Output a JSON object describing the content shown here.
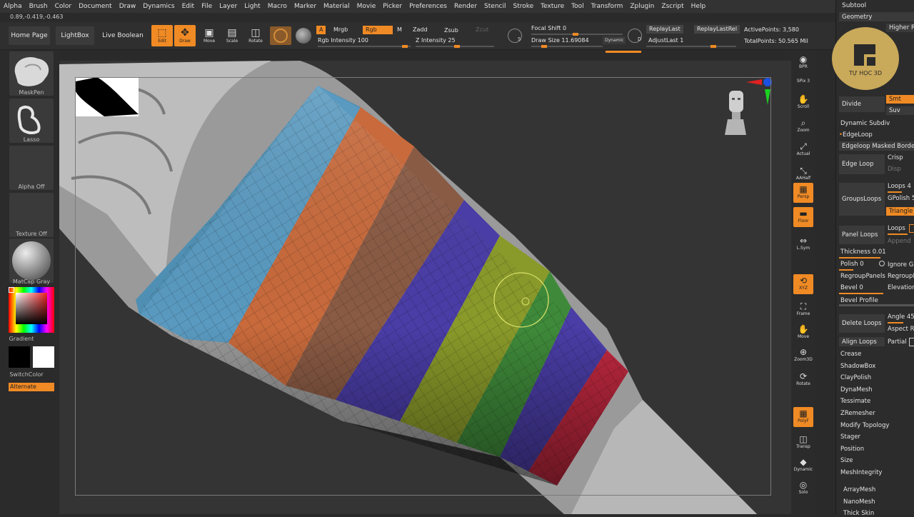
{
  "menu": [
    "Alpha",
    "Brush",
    "Color",
    "Document",
    "Draw",
    "Dynamics",
    "Edit",
    "File",
    "Layer",
    "Light",
    "Macro",
    "Marker",
    "Material",
    "Movie",
    "Picker",
    "Preferences",
    "Render",
    "Stencil",
    "Stroke",
    "Texture",
    "Tool",
    "Transform",
    "Zplugin",
    "Zscript",
    "Help"
  ],
  "coords": "0.89,-0.419,-0.463",
  "toolbar": {
    "home_page": "Home Page",
    "lightbox": "LightBox",
    "live_boolean": "Live Boolean",
    "edit": "Edit",
    "draw": "Draw",
    "move": "Move",
    "scale": "Scale",
    "rotate": "Rotate",
    "a_tag": "A",
    "mrgb": "Mrgb",
    "rgb": "Rgb",
    "m_tag": "M",
    "zadd": "Zadd",
    "zsub": "Zsub",
    "zcut": "Zcut",
    "rgb_intensity": "Rgb Intensity 100",
    "z_intensity": "Z Intensity 25",
    "focal_shift": "Focal Shift 0",
    "draw_size": "Draw Size 11.69084",
    "dynamic": "Dynamic",
    "s_key": "S",
    "d_key": "D",
    "replay_last": "ReplayLast",
    "replay_last_rel": "ReplayLastRel",
    "adjust_last": "AdjustLast 1",
    "active_points": "ActivePoints: 3,580",
    "total_points": "TotalPoints: 50.565 Mil"
  },
  "left": {
    "maskpen": "MaskPen",
    "lasso": "Lasso",
    "alpha_off": "Alpha Off",
    "texture_off": "Texture Off",
    "matcap": "MatCap Gray",
    "gradient": "Gradient",
    "switch_color": "SwitchColor",
    "alternate": "Alternate"
  },
  "right_shelf": [
    {
      "label": "BPR",
      "icon": "bpr-icon"
    },
    {
      "label": "SPix 3",
      "icon": "spix-icon"
    },
    {
      "label": "Scroll",
      "icon": "scroll-icon"
    },
    {
      "label": "Zoom",
      "icon": "zoom-icon"
    },
    {
      "label": "Actual",
      "icon": "actual-icon"
    },
    {
      "label": "AAHalf",
      "icon": "aahalf-icon"
    },
    {
      "label": "Persp",
      "icon": "persp-icon"
    },
    {
      "label": "Floor",
      "icon": "floor-icon"
    },
    {
      "label": "L.Sym",
      "icon": "lsym-icon"
    },
    {
      "label": "XYZ",
      "icon": "xyz-icon"
    },
    {
      "label": "Frame",
      "icon": "frame-icon"
    },
    {
      "label": "Move",
      "icon": "move-icon"
    },
    {
      "label": "Zoom3D",
      "icon": "zoom3d-icon"
    },
    {
      "label": "Rotate",
      "icon": "rotate-icon"
    },
    {
      "label": "PolyF",
      "icon": "polyf-icon"
    },
    {
      "label": "Transp",
      "icon": "transp-icon"
    },
    {
      "label": "Dynamic",
      "icon": "dynamic-icon"
    },
    {
      "label": "Solo",
      "icon": "solo-icon"
    }
  ],
  "panel": {
    "subtool": "Subtool",
    "geometry": "Geometry",
    "higher_res": "Higher Re",
    "watermark_brand": "TỰ HỌC 3D",
    "divide": "Divide",
    "smt": "Smt",
    "suv": "Suv",
    "dynamic_subdiv": "Dynamic Subdiv",
    "edgeloop": "EdgeLoop",
    "edgeloop_masked_border": "Edgeloop Masked Border",
    "edge_loop": "Edge Loop",
    "crisp": "Crisp",
    "disp": "Disp",
    "groups_loops": "GroupsLoops",
    "loops4": "Loops 4",
    "gpolish": "GPolish 5",
    "triangle": "Triangle",
    "panel_loops": "Panel Loops",
    "loops": "Loops",
    "append": "Append",
    "thickness": "Thickness 0.01",
    "polish": "Polish 0",
    "ignore_gr": "Ignore Gr",
    "regroup_panels": "RegroupPanels",
    "regroup_l": "RegroupL",
    "bevel": "Bevel 0",
    "elevation": "Elevation",
    "bevel_profile": "Bevel Profile",
    "delete_loops": "Delete Loops",
    "angle": "Angle 45",
    "aspect_ra": "Aspect Ra",
    "align_loops": "Align Loops",
    "partial": "Partial",
    "items": [
      "Crease",
      "ShadowBox",
      "ClayPolish",
      "DynaMesh",
      "Tessimate",
      "ZRemesher",
      "Modify Topology",
      "Stager",
      "Position",
      "Size",
      "MeshIntegrity"
    ],
    "array_mesh": "ArrayMesh",
    "nano_mesh": "NanoMesh",
    "thick_skin": "Thick Skin"
  },
  "colors": {
    "accent": "#f08a24",
    "band_blue": "#4f8fb3",
    "band_orange": "#c86a3c",
    "band_brown": "#8a5b44",
    "band_purple": "#4a3da6",
    "band_olive": "#8a9a2a",
    "band_green": "#3f8a3a",
    "band_red": "#c0283f"
  }
}
